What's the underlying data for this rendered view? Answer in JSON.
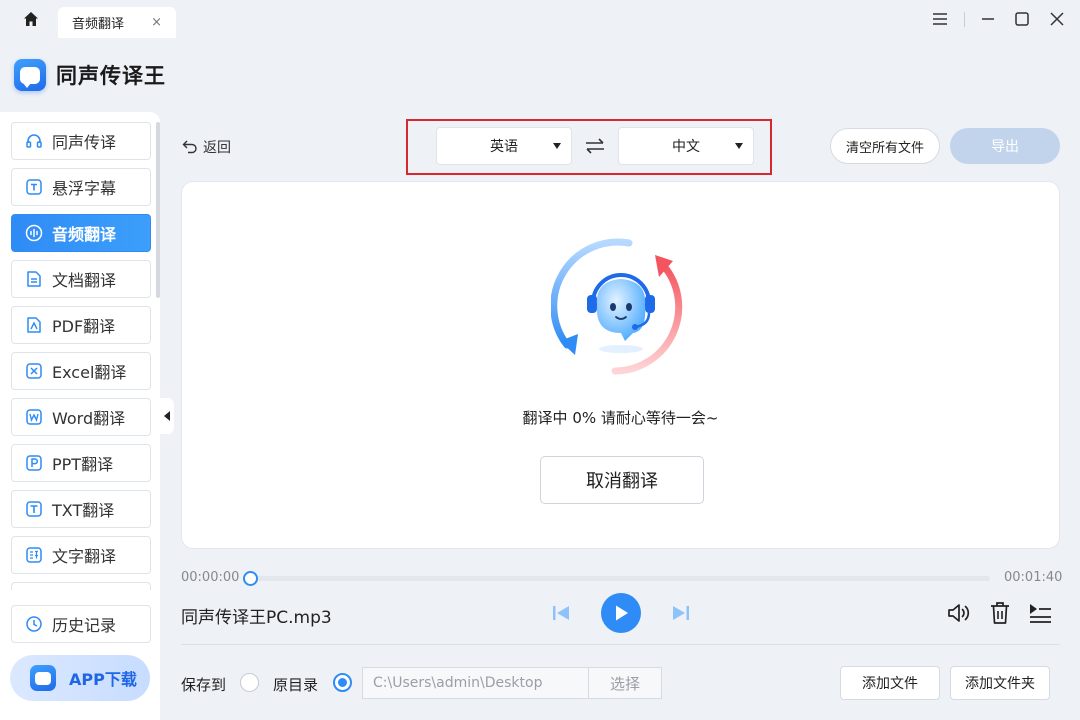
{
  "window": {
    "tab_label": "音频翻译",
    "tab_close": "×"
  },
  "brand": {
    "title": "同声传译王"
  },
  "sidebar": {
    "items": [
      {
        "label": "同声传译",
        "icon": "headset-icon"
      },
      {
        "label": "悬浮字幕",
        "icon": "subtitle-icon"
      },
      {
        "label": "音频翻译",
        "icon": "audio-wave-icon",
        "active": true
      },
      {
        "label": "文档翻译",
        "icon": "document-icon"
      },
      {
        "label": "PDF翻译",
        "icon": "pdf-icon"
      },
      {
        "label": "Excel翻译",
        "icon": "excel-icon"
      },
      {
        "label": "Word翻译",
        "icon": "word-icon"
      },
      {
        "label": "PPT翻译",
        "icon": "ppt-icon"
      },
      {
        "label": "TXT翻译",
        "icon": "txt-icon"
      },
      {
        "label": "文字翻译",
        "icon": "text-translate-icon"
      }
    ],
    "history_label": "历史记录",
    "app_download_label": "APP下载"
  },
  "toolbar": {
    "back_label": "返回",
    "source_language": "英语",
    "target_language": "中文",
    "clear_label": "清空所有文件",
    "export_label": "导出"
  },
  "status": {
    "progress_text": "翻译中 0% 请耐心等待一会~",
    "progress_percent": 0,
    "cancel_label": "取消翻译"
  },
  "player": {
    "current_time": "00:00:00",
    "duration": "00:01:40",
    "position_fraction": 0,
    "file_name": "同声传译王PC.mp3"
  },
  "output": {
    "save_to_label": "保存到",
    "original_dir_label": "原目录",
    "selected": "custom-path",
    "path_value": "C:\\Users\\admin\\Desktop",
    "choose_label": "选择",
    "add_file_label": "添加文件",
    "add_folder_label": "添加文件夹"
  },
  "colors": {
    "accent": "#2f8bf5",
    "highlight_box": "#d9272e",
    "export_disabled": "#c2d4ec",
    "background": "#eef1f6"
  }
}
